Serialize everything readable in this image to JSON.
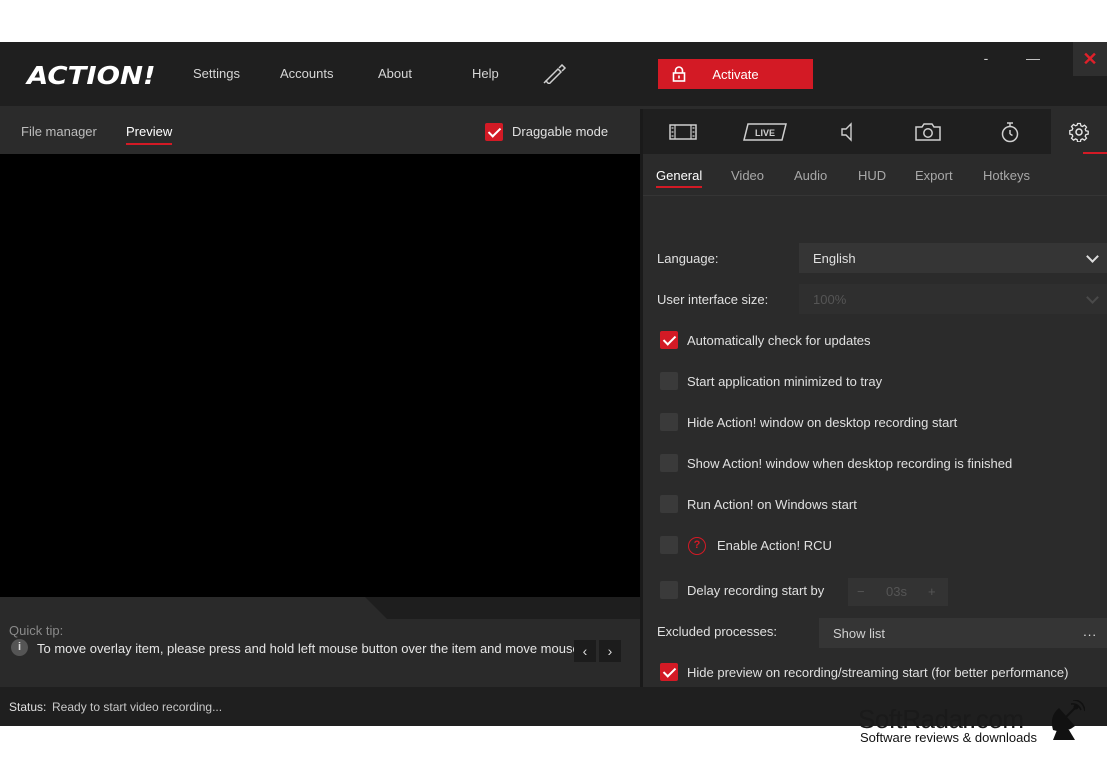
{
  "app": {
    "logo": "ACTION!"
  },
  "menu": {
    "settings": "Settings",
    "accounts": "Accounts",
    "about": "About",
    "help": "Help"
  },
  "activate_label": "Activate",
  "window": {
    "minimize_glyph": "-",
    "maximize_glyph": "—",
    "close_glyph": "✕"
  },
  "left_tabs": {
    "file_manager": "File manager",
    "preview": "Preview"
  },
  "draggable_mode": {
    "label": "Draggable mode",
    "checked": true
  },
  "quick_tip": {
    "title": "Quick tip:",
    "text": "To move overlay item, please press and hold left mouse button over the item and move mouse",
    "prev": "‹",
    "next": "›"
  },
  "status": {
    "key": "Status:",
    "value": "Ready to start video recording..."
  },
  "modes": [
    "video-mode",
    "live-mode",
    "audio-mode",
    "screenshot-mode",
    "timer-mode",
    "settings-mode"
  ],
  "live_badge": "LIVE",
  "settings_tabs": [
    "General",
    "Video",
    "Audio",
    "HUD",
    "Export",
    "Hotkeys"
  ],
  "general": {
    "language_label": "Language:",
    "language_value": "English",
    "ui_size_label": "User interface size:",
    "ui_size_value": "100%",
    "options": [
      {
        "label": "Automatically check for updates",
        "checked": true
      },
      {
        "label": "Start application minimized to tray",
        "checked": false
      },
      {
        "label": "Hide Action! window on desktop recording start",
        "checked": false
      },
      {
        "label": "Show Action! window when desktop recording is finished",
        "checked": false
      },
      {
        "label": "Run Action! on Windows start",
        "checked": false
      },
      {
        "label": "Enable Action! RCU",
        "checked": false
      }
    ],
    "delay_label": "Delay recording start by",
    "delay_checked": false,
    "delay_minus": "−",
    "delay_value": "03s",
    "delay_plus": "+",
    "excluded_label": "Excluded processes:",
    "show_list": "Show list",
    "show_list_dots": "...",
    "hide_preview_label": "Hide preview on recording/streaming start (for better performance)",
    "hide_preview_checked": true,
    "rcu_warning_glyph": "?"
  },
  "watermark": {
    "title": "SoftRadar.com",
    "subtitle": "Software reviews & downloads"
  },
  "colors": {
    "accent": "#d31a25",
    "background": "#2b2b2b",
    "titlebar": "#1f1f1f"
  }
}
